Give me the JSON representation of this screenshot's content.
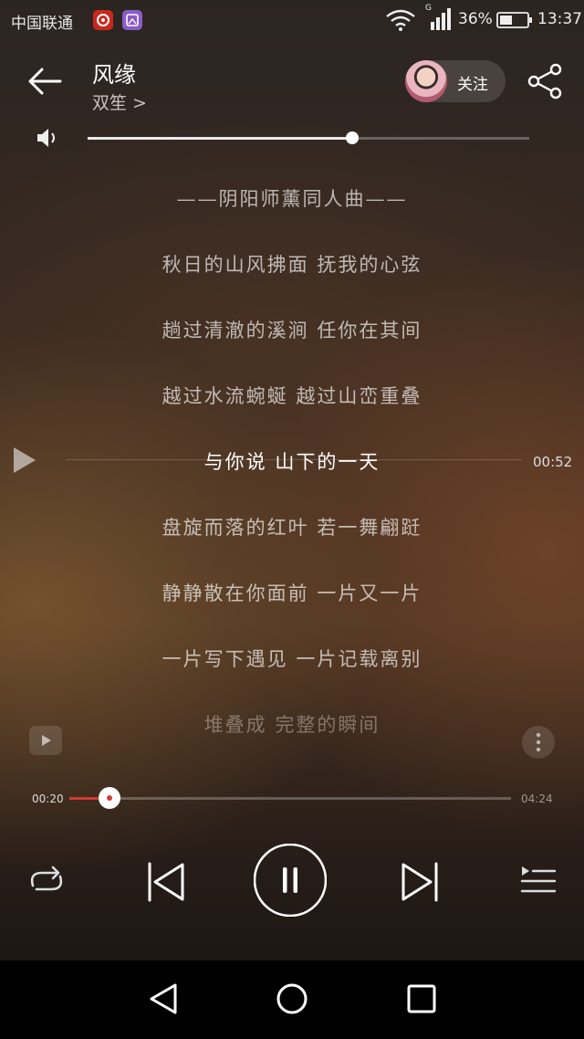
{
  "status_bar": {
    "carrier": "中国联通",
    "battery_percent": "36%",
    "network_type": "G",
    "time": "13:37"
  },
  "header": {
    "song_title": "风缘",
    "artist": "双笙 >",
    "follow_label": "关注"
  },
  "volume": {
    "level": 0.6
  },
  "lyrics": [
    {
      "text": "——阴阳师薰同人曲——",
      "state": "normal"
    },
    {
      "text": "秋日的山风拂面 抚我的心弦",
      "state": "normal"
    },
    {
      "text": "趟过清澈的溪涧 任你在其间",
      "state": "normal"
    },
    {
      "text": "越过水流蜿蜒 越过山峦重叠",
      "state": "normal"
    },
    {
      "text": "与你说 山下的一天",
      "state": "current"
    },
    {
      "text": "盘旋而落的红叶 若一舞翩跹",
      "state": "normal"
    },
    {
      "text": "静静散在你面前 一片又一片",
      "state": "normal"
    },
    {
      "text": "一片写下遇见 一片记载离别",
      "state": "normal"
    },
    {
      "text": "堆叠成 完整的瞬间",
      "state": "faded"
    }
  ],
  "lyric_seek_time": "00:52",
  "playback": {
    "elapsed": "00:20",
    "total": "04:24",
    "progress": 0.091
  },
  "colors": {
    "accent": "#d23a30",
    "netease_badge": "#c8281e",
    "gallery_badge": "#8a5cc8"
  },
  "icons": {
    "back": "arrow-left-icon",
    "share": "share-icon",
    "volume": "speaker-icon",
    "repeat": "repeat-icon",
    "previous": "skip-previous-icon",
    "pause": "pause-icon",
    "next": "skip-next-icon",
    "playlist": "playlist-icon",
    "video": "video-play-icon",
    "more": "more-vertical-icon"
  }
}
